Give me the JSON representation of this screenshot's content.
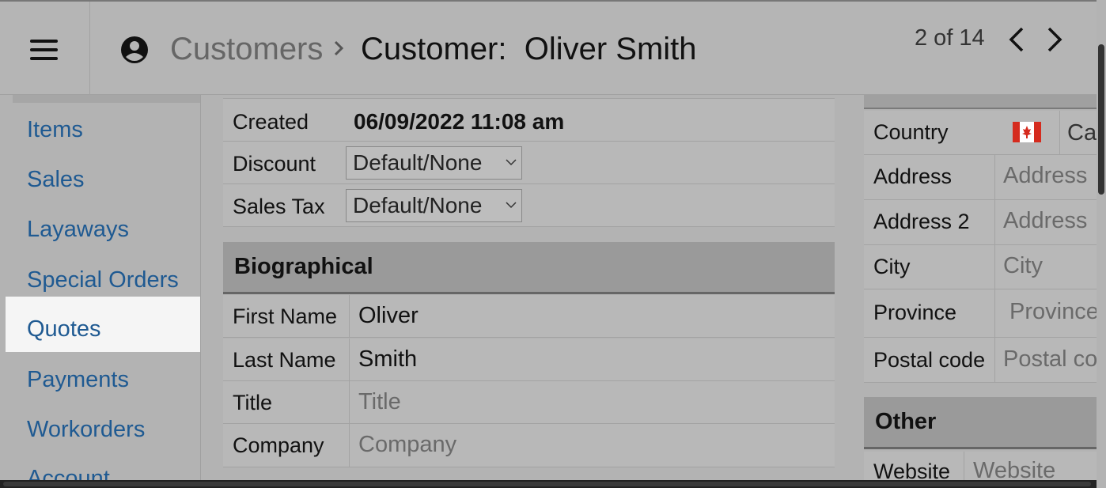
{
  "header": {
    "menu_icon": "hamburger-menu-icon",
    "breadcrumb_icon": "user-circle-icon",
    "breadcrumb_parent": "Customers",
    "breadcrumb_separator_icon": "chevron-right-icon",
    "title": "Customer:  Oliver Smith",
    "pager": "2 of 14",
    "prev_icon": "chevron-left-icon",
    "next_icon": "chevron-right-icon"
  },
  "sidebar": {
    "items": [
      {
        "label": "Items"
      },
      {
        "label": "Sales"
      },
      {
        "label": "Layaways"
      },
      {
        "label": "Special Orders"
      },
      {
        "label": "Quotes",
        "active": true
      },
      {
        "label": "Payments"
      },
      {
        "label": "Workorders"
      },
      {
        "label": "Account"
      }
    ]
  },
  "details": {
    "created_label": "Created",
    "created_value": "06/09/2022 11:08 am",
    "discount_label": "Discount",
    "discount_value": "Default/None",
    "sales_tax_label": "Sales Tax",
    "sales_tax_value": "Default/None"
  },
  "biographical": {
    "heading": "Biographical",
    "first_name_label": "First Name",
    "first_name_value": "Oliver",
    "last_name_label": "Last Name",
    "last_name_value": "Smith",
    "title_label": "Title",
    "title_placeholder": "Title",
    "company_label": "Company",
    "company_placeholder": "Company"
  },
  "address": {
    "country_label": "Country",
    "country_flag_icon": "canada-flag-icon",
    "country_value": "Ca",
    "address_label": "Address",
    "address_placeholder": "Address",
    "address2_label": "Address 2",
    "address2_placeholder": "Address",
    "city_label": "City",
    "city_placeholder": "City",
    "province_label": "Province",
    "province_placeholder": "Province",
    "postal_label": "Postal code",
    "postal_placeholder": "Postal code"
  },
  "other": {
    "heading": "Other",
    "website_label": "Website",
    "website_placeholder": "Website"
  },
  "colors": {
    "link": "#1f5a92",
    "active_bg": "#f5f5f5",
    "flag_red": "#d52b1e"
  }
}
